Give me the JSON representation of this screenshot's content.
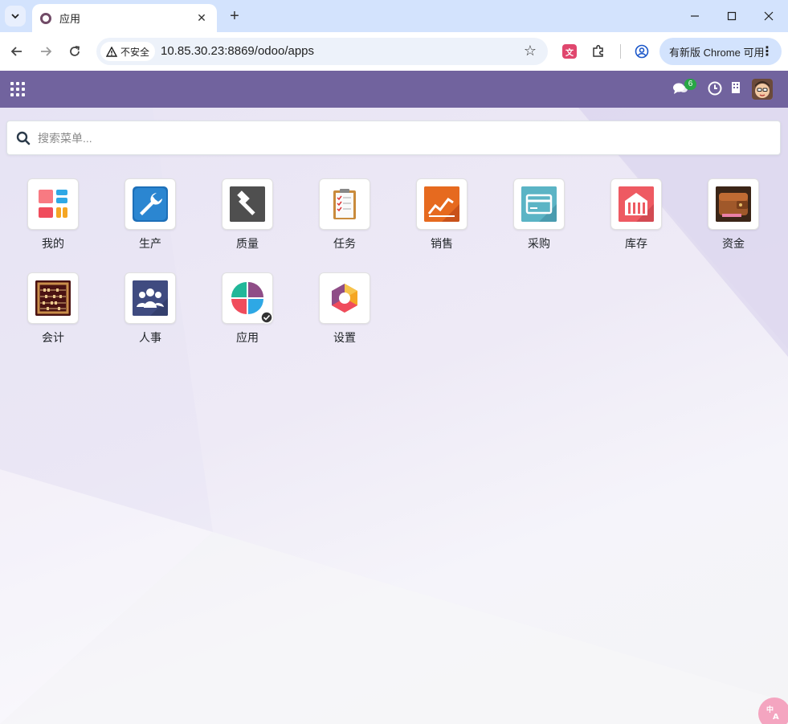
{
  "browser": {
    "tab_title": "应用",
    "security_label": "不安全",
    "url": "10.85.30.23:8869/odoo/apps",
    "update_label": "有新版 Chrome 可用"
  },
  "navbar": {
    "chat_count": "6",
    "brand_color": "#71639e"
  },
  "search": {
    "placeholder": "搜索菜单..."
  },
  "apps": [
    {
      "label": "我的",
      "icon": "dashboard-icon"
    },
    {
      "label": "生产",
      "icon": "wrench-icon"
    },
    {
      "label": "质量",
      "icon": "hammer-icon"
    },
    {
      "label": "任务",
      "icon": "clipboard-icon"
    },
    {
      "label": "销售",
      "icon": "trend-chart-icon"
    },
    {
      "label": "采购",
      "icon": "credit-card-icon"
    },
    {
      "label": "库存",
      "icon": "warehouse-icon"
    },
    {
      "label": "资金",
      "icon": "wallet-icon"
    },
    {
      "label": "会计",
      "icon": "abacus-icon"
    },
    {
      "label": "人事",
      "icon": "people-icon"
    },
    {
      "label": "应用",
      "icon": "apps-logo-icon"
    },
    {
      "label": "设置",
      "icon": "settings-hexagon-icon"
    }
  ]
}
